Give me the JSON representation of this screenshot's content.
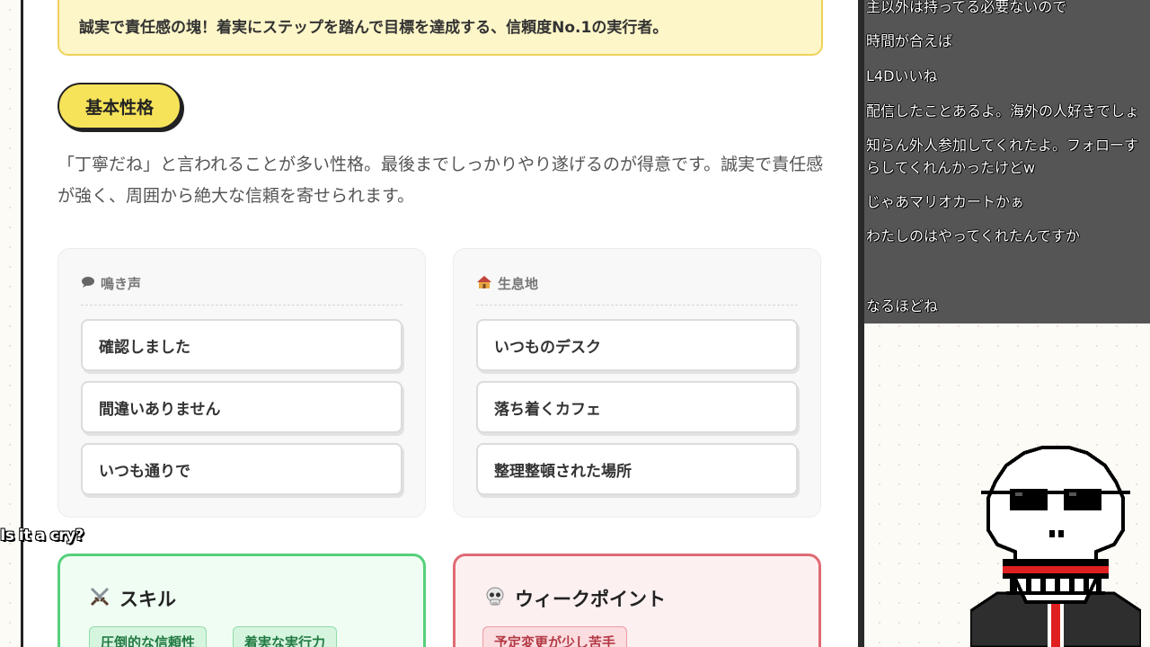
{
  "profile": {
    "tagline": "誠実で責任感の塊！着実にステップを踏んで目標を達成する、信頼度No.1の実行者。",
    "section_title": "基本性格",
    "description": "「丁寧だね」と言われることが多い性格。最後までしっかりやり遂げるのが得意です。誠実で責任感が強く、周囲から絶大な信頼を寄せられます。",
    "cards": {
      "voice": {
        "icon": "speech-icon",
        "title": "鳴き声",
        "items": [
          "確認しました",
          "間違いありません",
          "いつも通りで"
        ]
      },
      "habitat": {
        "icon": "house-icon",
        "title": "生息地",
        "items": [
          "いつものデスク",
          "落ち着くカフェ",
          "整理整頓された場所"
        ]
      }
    },
    "skill": {
      "icon": "crossed-swords-icon",
      "title": "スキル",
      "tags": [
        "圧倒的な信頼性",
        "着実な実行力"
      ]
    },
    "weak": {
      "icon": "skull-icon",
      "title": "ウィークポイント",
      "tags": [
        "予定変更が少し苦手"
      ]
    }
  },
  "chat": {
    "messages": [
      "主以外は持ってる必要ないので",
      "時間が合えば",
      "L4Dいいね",
      "配信したことあるよ。海外の人好きでしょ",
      "知らん外人参加してくれたよ。フォローすらしてくれんかったけどw",
      "じゃあマリオカートかぁ",
      "わたしのはやってくれたんですか",
      "なるほどね"
    ]
  },
  "overlay": {
    "caption": "Is it a cry?",
    "avatar_icon": "pixel-skull-avatar-icon"
  },
  "colors": {
    "tagline_bg": "#fdf6c8",
    "pill_yellow": "#f7e35a",
    "skill_green": "#55d07a",
    "weak_red": "#e06a74",
    "chat_bg": "#555555"
  }
}
